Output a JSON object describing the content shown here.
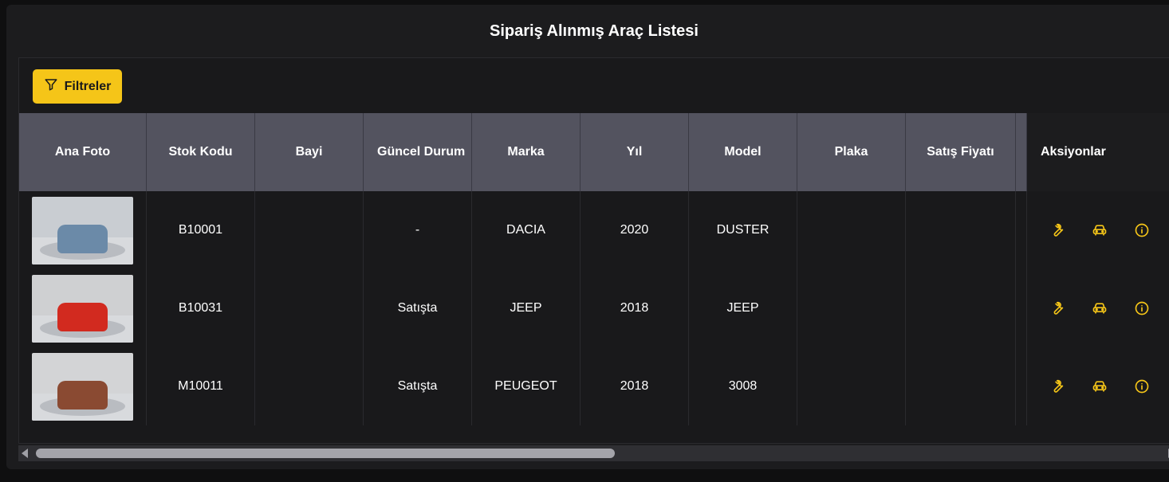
{
  "page": {
    "title": "Sipariş Alınmış Araç Listesi"
  },
  "toolbar": {
    "filter_label": "Filtreler"
  },
  "table": {
    "columns": [
      {
        "label": "Ana Foto"
      },
      {
        "label": "Stok Kodu"
      },
      {
        "label": "Bayi"
      },
      {
        "label": "Güncel Durum"
      },
      {
        "label": "Marka"
      },
      {
        "label": "Yıl"
      },
      {
        "label": "Model"
      },
      {
        "label": "Plaka"
      },
      {
        "label": "Satış Fiyatı"
      },
      {
        "label": "Aksiyonlar"
      }
    ],
    "rows": [
      {
        "stok_kodu": "B10001",
        "bayi": "",
        "durum": "-",
        "marka": "DACIA",
        "yil": "2020",
        "model": "DUSTER",
        "plaka": "",
        "fiyat": "",
        "car_color": "#6b8aa8"
      },
      {
        "stok_kodu": "B10031",
        "bayi": "",
        "durum": "Satışta",
        "marka": "JEEP",
        "yil": "2018",
        "model": "JEEP",
        "plaka": "",
        "fiyat": "",
        "car_color": "#d22a1f"
      },
      {
        "stok_kodu": "M10011",
        "bayi": "",
        "durum": "Satışta",
        "marka": "PEUGEOT",
        "yil": "2018",
        "model": "3008",
        "plaka": "",
        "fiyat": "",
        "car_color": "#8a4a32"
      }
    ]
  },
  "colors": {
    "accent": "#f5c518",
    "header_bg": "#53535f",
    "background": "#1c1c1e"
  },
  "icons": {
    "filter": "filter-icon",
    "service": "wrench-icon",
    "vehicle": "car-icon",
    "info": "info-icon"
  }
}
